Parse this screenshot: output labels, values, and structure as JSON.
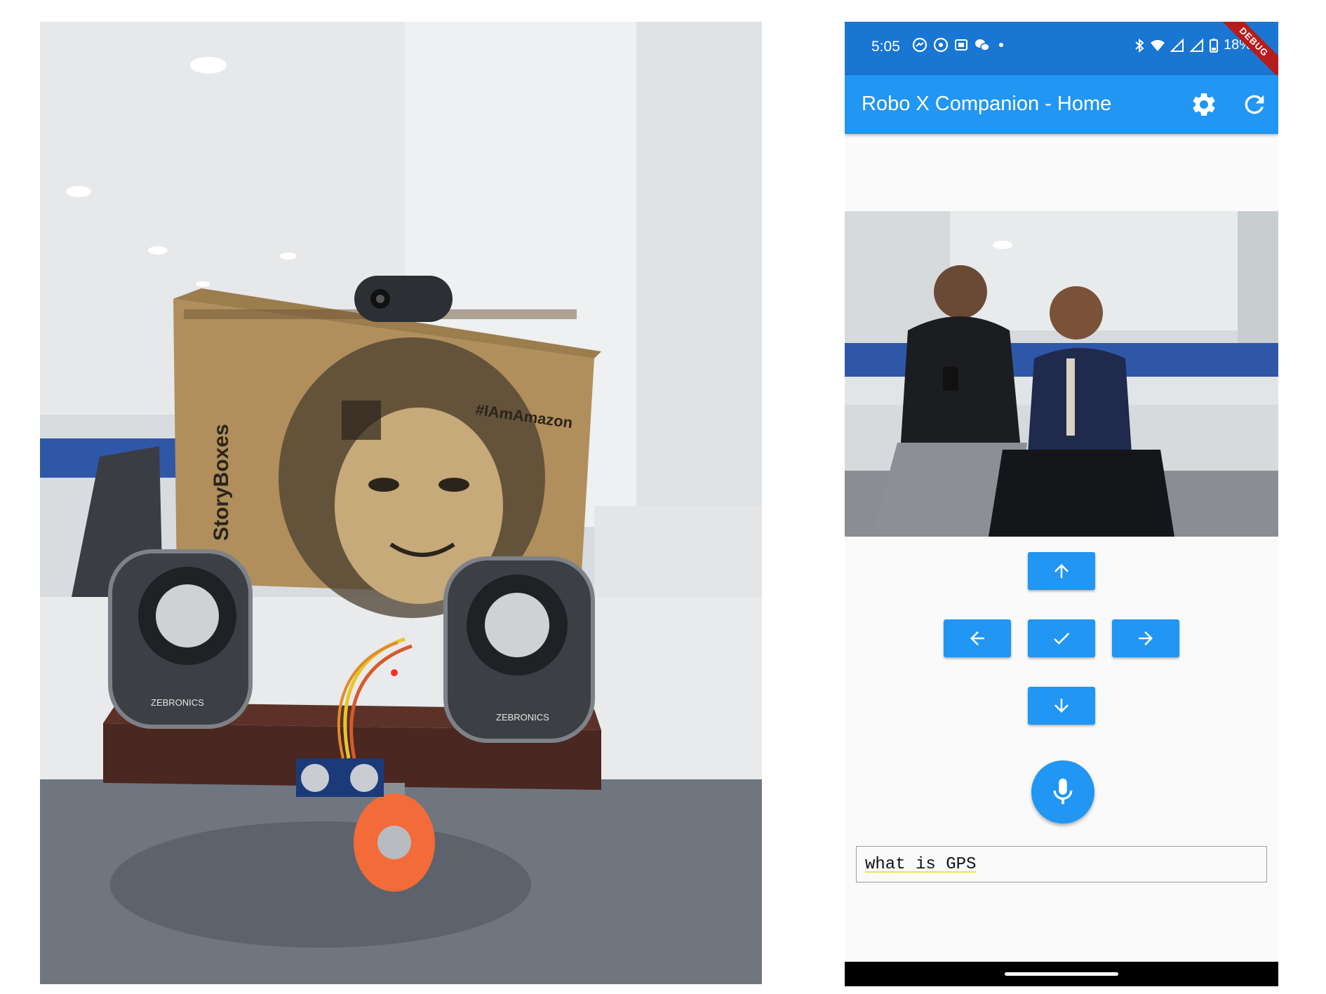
{
  "status_bar": {
    "time": "5:05",
    "battery": "18%",
    "debug_banner": "DEBUG"
  },
  "app_bar": {
    "title": "Robo X Companion - Home",
    "settings_icon": "gear-icon",
    "refresh_icon": "refresh-icon"
  },
  "controls": {
    "up_icon": "arrow-up-icon",
    "left_icon": "arrow-left-icon",
    "confirm_icon": "check-icon",
    "right_icon": "arrow-right-icon",
    "down_icon": "arrow-down-icon",
    "mic_icon": "mic-icon"
  },
  "speech": {
    "text": "what is GPS"
  },
  "photo_text": {
    "box_brand": "StoryBoxes",
    "box_hashtag": "#IAmAmazon",
    "speaker_brand": "ZEBRONICS"
  },
  "colors": {
    "status_bar": "#1976d2",
    "app_bar": "#2196f3",
    "button": "#2196f3",
    "debug_banner": "#b71c1c"
  }
}
